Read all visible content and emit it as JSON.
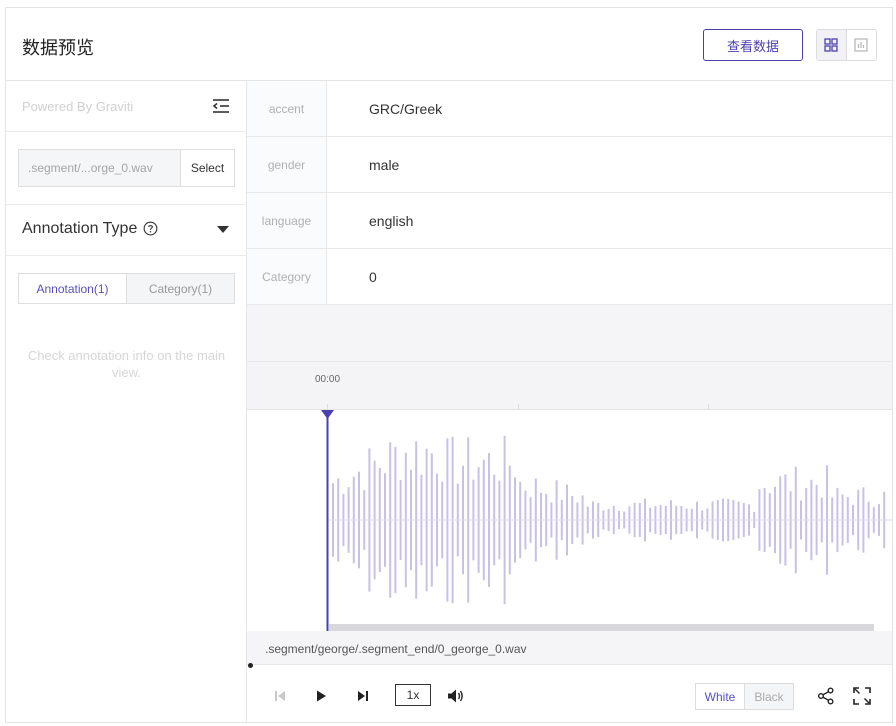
{
  "header": {
    "title": "数据预览",
    "view_data_label": "查看数据",
    "mode_buttons": [
      "grid-view-icon",
      "chart-view-icon"
    ]
  },
  "sidebar": {
    "powered_by": "Powered By Graviti",
    "file_input_value": ".segment/...orge_0.wav",
    "select_label": "Select",
    "annotation_type_label": "Annotation Type",
    "tabs": [
      {
        "label": "Annotation(1)",
        "active": true
      },
      {
        "label": "Category(1)",
        "active": false
      }
    ],
    "hint": "Check annotation info on the main view."
  },
  "metadata": [
    {
      "key": "accent",
      "value": "GRC/Greek"
    },
    {
      "key": "gender",
      "value": "male"
    },
    {
      "key": "language",
      "value": "english"
    },
    {
      "key": "Category",
      "value": "0"
    }
  ],
  "player": {
    "time_start": "00:00",
    "filename": ".segment/george/.segment_end/0_george_0.wav",
    "speed": "1x",
    "theme_white": "White",
    "theme_black": "Black",
    "accent_color": "#4b3fb0",
    "wave_color": "#c9c0e6"
  }
}
